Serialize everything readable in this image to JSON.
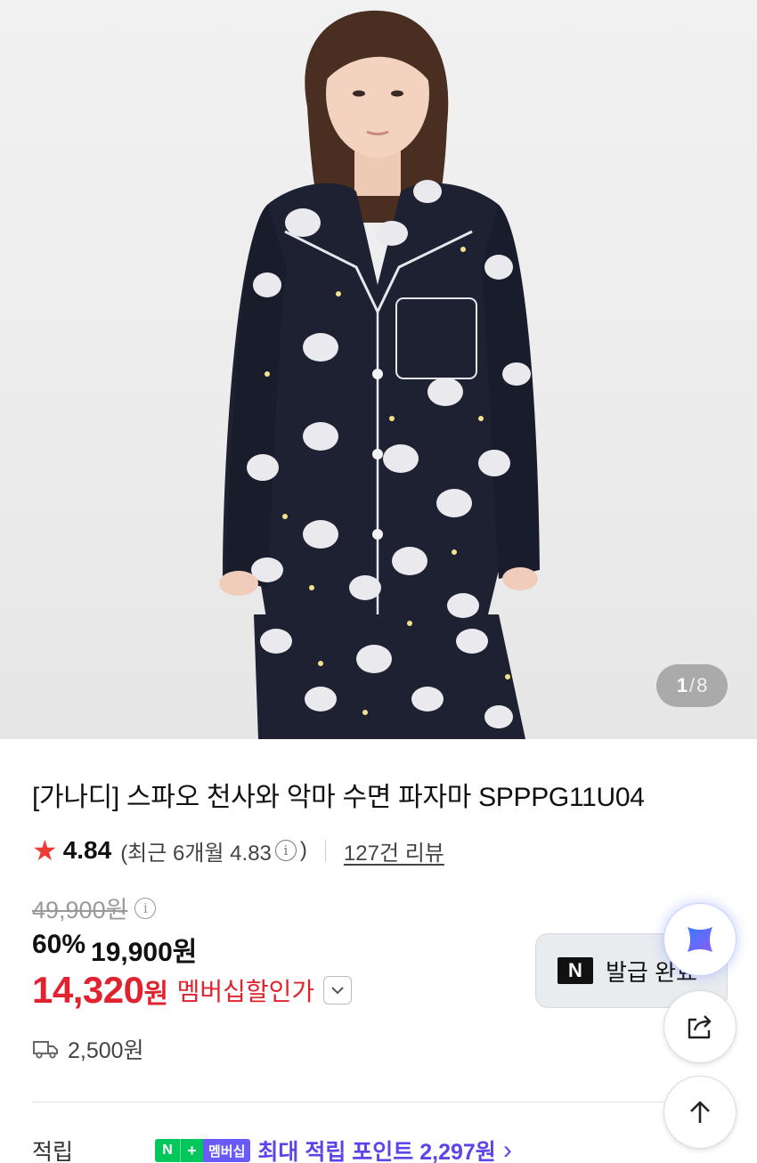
{
  "gallery": {
    "current": "1",
    "separator": "/",
    "total": "8"
  },
  "product": {
    "title": "[가나디] 스파오 천사와 악마 수면 파자마 SPPPG11U04"
  },
  "rating": {
    "star_icon": "star-icon",
    "score": "4.84",
    "recent_open": "(최근 6개월 4.83",
    "recent_close": ")",
    "info_glyph": "i",
    "reviews": "127건 리뷰"
  },
  "price": {
    "original": "49,900원",
    "discount_rate": "60%",
    "sale": "19,900원",
    "member_amount": "14,320",
    "member_unit": "원",
    "member_label": "멤버십할인가"
  },
  "shipping": {
    "icon": "truck-icon",
    "fee": "2,500원"
  },
  "points": {
    "label": "적립",
    "badge_n": "N",
    "badge_plus": "+",
    "badge_text": "멤버십",
    "text": "최대 적립 포인트 2,297원",
    "chevron": "›"
  },
  "coupon": {
    "logo": "N",
    "label": "발급 완료"
  },
  "floating": {
    "ai_icon": "sparkle-x-icon",
    "share_icon": "share-icon",
    "top_icon": "arrow-up-icon"
  },
  "colors": {
    "accent_red": "#e0232e",
    "star_red": "#ec3b33",
    "points_purple": "#5a45e8",
    "naver_green": "#03c75a"
  }
}
